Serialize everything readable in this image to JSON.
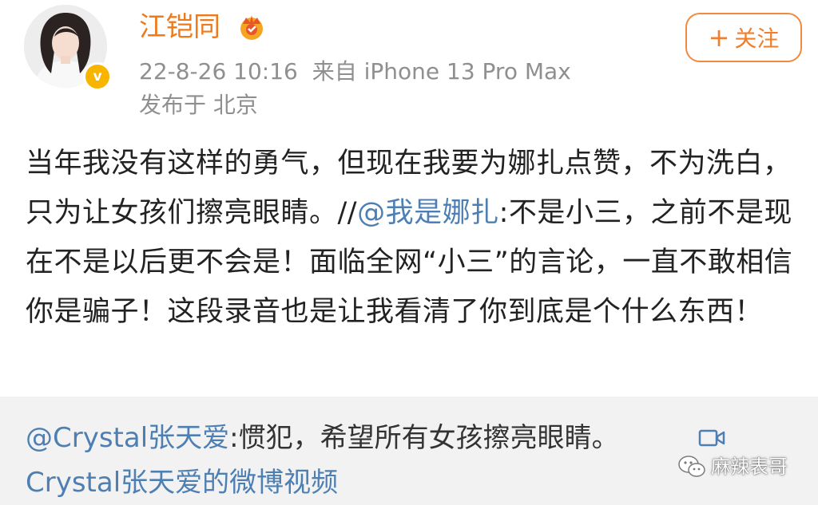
{
  "header": {
    "username": "江铠同",
    "timestamp": "22-8-26 10:16",
    "source": "来自 iPhone 13 Pro Max",
    "location": "发布于 北京",
    "follow_label": "关注",
    "verify_badge": "v",
    "crown_icon": "crown-icon",
    "accent_color": "#ef7a1b"
  },
  "post": {
    "text_part1": "当年我没有这样的勇气，但现在我要为娜扎点赞，不为洗白，只为让女孩们擦亮眼睛。//",
    "mention": "@我是娜扎",
    "text_part2": ":不是小三，之前不是现在不是以后更不会是！面临全网“小三”的言论，一直不敢相信你是骗子！这段录音也是让我看清了你到底是个什么东西！"
  },
  "repost": {
    "mention": "@Crystal张天爱",
    "text": ":惯犯，希望所有女孩擦亮眼睛。",
    "video_icon": "video-camera-icon",
    "video_link": "Crystal张天爱的微博视频"
  },
  "watermark": {
    "text": "麻辣表哥",
    "icon": "wechat-icon"
  }
}
